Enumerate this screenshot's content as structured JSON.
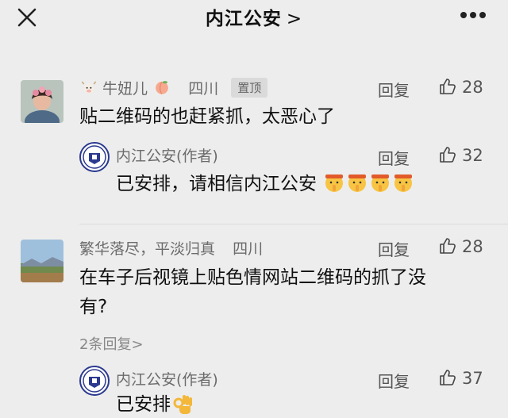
{
  "header": {
    "title": "内江公安",
    "chevron": ">"
  },
  "comments": [
    {
      "author": "牛妞儿",
      "location": "四川",
      "badge": "置顶",
      "text": "贴二维码的也赶紧抓，太恶心了",
      "reply_label": "回复",
      "likes": "28",
      "replies": [
        {
          "author": "内江公安(作者)",
          "text": "已安排，请相信内江公安",
          "reply_label": "回复",
          "likes": "32"
        }
      ]
    },
    {
      "author": "繁华落尽，平淡归真",
      "location": "四川",
      "text_line1": "在车子后视镜上贴色情网站二维码的抓了没",
      "text_line2": "有?",
      "reply_label": "回复",
      "likes": "28",
      "more_replies": "2条回复>",
      "replies": [
        {
          "author": "内江公安(作者)",
          "text": "已安排",
          "reply_label": "回复",
          "likes": "37"
        }
      ]
    }
  ],
  "colors": {
    "badge_bg": "#dadada",
    "background": "#ededed",
    "logo_blue": "#2b3a8f"
  },
  "icons": [
    "close-icon",
    "more-icon",
    "thumbs-up-icon",
    "shush-emoji",
    "ok-hand-emoji",
    "peach-emoji",
    "cow-emoji"
  ]
}
